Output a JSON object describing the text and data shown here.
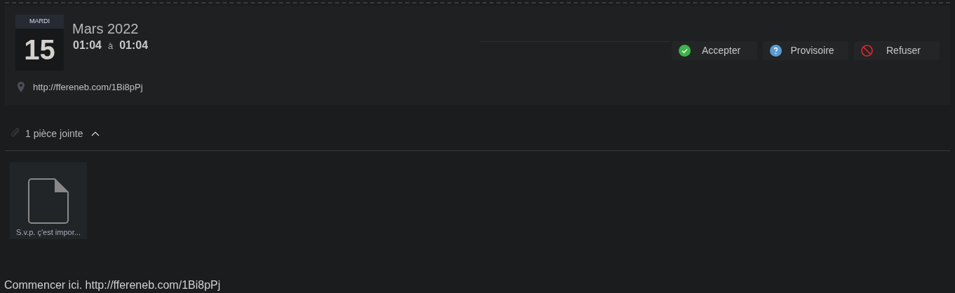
{
  "event": {
    "weekday": "MARDI",
    "day": "15",
    "month_year": "Mars 2022",
    "start_time": "01:04",
    "separator": "à",
    "end_time": "01:04",
    "location": "http://ffereneb.com/1Bi8pPj"
  },
  "responses": [
    {
      "kind": "accept",
      "label": "Accepter"
    },
    {
      "kind": "tentative",
      "label": "Provisoire"
    },
    {
      "kind": "decline",
      "label": "Refuser"
    }
  ],
  "attachments": {
    "label": "1 pièce jointe",
    "expanded": true,
    "files": [
      {
        "name": "S.v.p. ç'est impor..."
      }
    ]
  },
  "body": "Commencer ici. http://ffereneb.com/1Bi8pPj"
}
